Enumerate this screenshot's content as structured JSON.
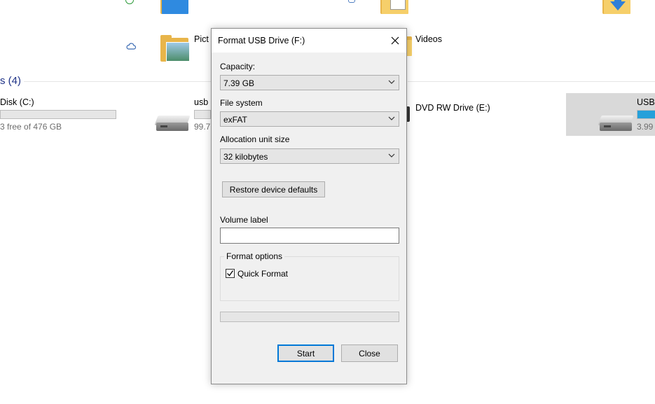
{
  "explorer": {
    "folders": {
      "pictures_label": "Pict",
      "videos_label": "Videos"
    },
    "devices_header": "s (4)",
    "drives": [
      {
        "label": "Disk (C:)",
        "sub": "3 free of 476 GB"
      },
      {
        "label": "usb",
        "sub": "99.7"
      },
      {
        "label": "DVD RW Drive (E:)",
        "sub": ""
      },
      {
        "label": "USB",
        "sub": "3.99"
      }
    ]
  },
  "dialog": {
    "title": "Format USB Drive (F:)",
    "capacity": {
      "label": "Capacity:",
      "value": "7.39 GB"
    },
    "file_system": {
      "label": "File system",
      "value": "exFAT"
    },
    "allocation": {
      "label": "Allocation unit size",
      "value": "32 kilobytes"
    },
    "restore_button": "Restore device defaults",
    "volume_label": {
      "label": "Volume label",
      "value": ""
    },
    "format_options": {
      "legend": "Format options",
      "quick_format": {
        "label": "Quick Format",
        "checked": true
      }
    },
    "progress": 0,
    "start_button": "Start",
    "close_button": "Close"
  },
  "colors": {
    "accent": "#0078d7",
    "usage_fill": "#26a0da",
    "header_blue": "#1e3287"
  }
}
